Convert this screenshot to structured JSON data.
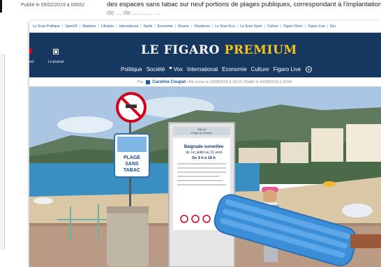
{
  "background": {
    "date": "Publié le 09/02/2019 à 00h52",
    "text_line1": "des espaces sans tabac sur neuf portions de plages publiques, correspondant à l'implantation",
    "text_line2": "de ... de ... ... ... ..."
  },
  "topnav": [
    "Le Scan Politique",
    "Sport24",
    "Madame",
    "Lifestyle",
    "International",
    "Santé",
    "Economie",
    "Bourse",
    "Décideurs",
    "Le Scan Eco",
    "Le Scan Sport",
    "Culture",
    "Figaro Store",
    "Figaro Live",
    "Etu"
  ],
  "header": {
    "left_item_label": "ect",
    "journal_label": "Le journal",
    "brand_main": "LE FIGARO",
    "brand_premium": "PREMIUM",
    "nav": [
      "Politique",
      "Société",
      "Vox",
      "International",
      "Economie",
      "Culture",
      "Figaro Live"
    ],
    "vox_mark": "❞",
    "plus_icon": "⊕"
  },
  "byline": {
    "prefix": "Par",
    "author": "Caroline Coupat",
    "meta": "| Mis à jour le 10/08/2018 à 19:12 | Publié le 10/08/2018 à 19:04"
  },
  "photo": {
    "plage_sign_line1": "PLAGE",
    "plage_sign_line2": "SANS",
    "plage_sign_line3": "TABAC",
    "notice_line1": "Baignade surveillée",
    "notice_line2": "du 1er juillet au 31 août",
    "notice_line3": "De 9 h à 18 h",
    "board_header1": "Ville de",
    "board_header2": "Plage du Fossan"
  },
  "colors": {
    "header_bg": "#163860",
    "premium_gold": "#f5c220",
    "link_blue": "#1a5aa8",
    "alert_red": "#e2001a"
  }
}
